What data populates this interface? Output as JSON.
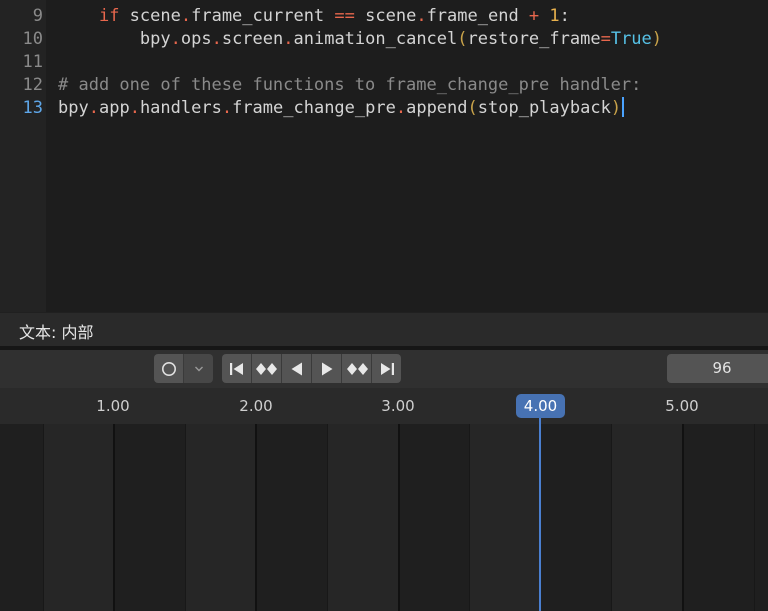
{
  "editor": {
    "lines": [
      {
        "num": "9",
        "current": false
      },
      {
        "num": "10",
        "current": false
      },
      {
        "num": "11",
        "current": false
      },
      {
        "num": "12",
        "current": false
      },
      {
        "num": "13",
        "current": true
      }
    ],
    "code": {
      "line9": {
        "indent": "    ",
        "kw": "if",
        "a": " scene",
        "dot1": ".",
        "b": "frame_current ",
        "eq": "==",
        "c": " scene",
        "dot2": ".",
        "d": "frame_end ",
        "plus": "+",
        "sp": " ",
        "one": "1",
        "colon": ":"
      },
      "line10": {
        "indent": "        ",
        "a": "bpy",
        "d1": ".",
        "b": "ops",
        "d2": ".",
        "c": "screen",
        "d3": ".",
        "d": "animation_cancel",
        "lp": "(",
        "e": "restore_frame",
        "eq": "=",
        "t": "True",
        "rp": ")"
      },
      "line12": "# add one of these functions to frame_change_pre handler:",
      "line13": {
        "a": "bpy",
        "d1": ".",
        "b": "app",
        "d2": ".",
        "c": "handlers",
        "d3": ".",
        "d": "frame_change_pre",
        "d4": ".",
        "e": "append",
        "lp": "(",
        "f": "stop_playback",
        "rp": ")"
      }
    }
  },
  "statusbar": {
    "text": "文本: 内部"
  },
  "timeline": {
    "current_frame": "96",
    "playhead_value": "4.00",
    "tick_labels": [
      "1.00",
      "2.00",
      "3.00",
      "4.00",
      "5.00"
    ],
    "transport_buttons": [
      "jump-to-start",
      "prev-keyframe",
      "play-reverse",
      "play",
      "next-keyframe",
      "jump-to-end"
    ]
  },
  "colors": {
    "accent": "#4772b3",
    "keyword": "#e8674d",
    "number": "#e8b14d",
    "constant": "#56c1e6",
    "comment": "#8a8a8a"
  }
}
